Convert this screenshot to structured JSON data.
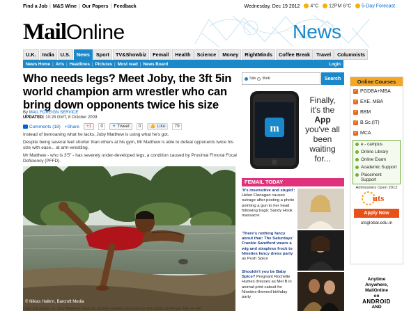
{
  "topbar": {
    "links": [
      "Find a Job",
      "M&S Wine",
      "Our Papers",
      "Feedback"
    ],
    "date": "Wednesday, Dec 19 2012",
    "temp_am": "4°C",
    "time": "12PM",
    "temp_pm": "6°C",
    "forecast": "5-Day Forecast"
  },
  "masthead": {
    "logo_bold": "Mail",
    "logo_light": "Online",
    "section": "News"
  },
  "nav": {
    "items": [
      "U.K.",
      "India",
      "U.S.",
      "News",
      "Sport",
      "TV&Showbiz",
      "Femail",
      "Health",
      "Science",
      "Money",
      "RightMinds",
      "Coffee Break",
      "Travel",
      "Columnists"
    ],
    "active": "News"
  },
  "subnav": {
    "items": [
      "News Home",
      "Arts",
      "Headlines",
      "Pictures",
      "Most read",
      "News Board"
    ],
    "login": "Login"
  },
  "article": {
    "headline": "Who needs legs? Meet Joby, the 3ft 5in world champion arm wrestler who can bring down opponents twice his size",
    "byline_prefix": "By",
    "author": "MAIL FOREIGN SERVICE",
    "updated_label": "UPDATED:",
    "updated_value": "10:28 GMT, 8 October 2009",
    "share": {
      "comments": "Comments (18)",
      "share": "Share",
      "plus_count": "0",
      "tweet": "Tweet",
      "tweet_count": "0",
      "like": "Like",
      "like_count": "79"
    },
    "paragraphs": [
      "Instead of bemoaning what he lacks, Joby Matthew is using what he's got.",
      "Despite being several feet shorter than others at his gym, Mr Matthew is able to defeat opponents twice his size with ease... at arm-wrestling.",
      "Mr Matthew - who is 3'5\" - has severely under-developed legs, a condition caused by Proximal Fimoral Focal Deficiency (PFFD)."
    ],
    "photo_credit": "© Niklas Halle'n, Barcroft Media",
    "caption_partial": "Lean but weigh: mr Joby Matthew does his routine morning exercises on the banks of Periyar river on the"
  },
  "search": {
    "opt_site": "Site",
    "opt_web": "Web",
    "button": "Search"
  },
  "app_ad": {
    "lines": [
      "Finally,",
      "it's the",
      "App",
      "you've all",
      "been",
      "waiting",
      "for..."
    ]
  },
  "femail": {
    "header": "FEMAIL TODAY",
    "stories": [
      {
        "title": "'It's insensitive and stupid':",
        "body": " Helen Flanagan causes outrage after posting a photo pointing a gun to her head following tragic Sandy Hook massacre"
      },
      {
        "title": "'There's nothing fancy about that: The Saturdays' Frankie Sandford wears a wig and strapless frock to Nineties fancy dress party",
        "body": " as Posh Spice"
      },
      {
        "title": "Shouldn't you be Baby Spice?",
        "body": " Pregnant Rochelle Humes dresses as Mel B in animal-print catsuit for Nineties-themed birthday party"
      }
    ]
  },
  "side_ad": {
    "header": "Online Courses",
    "courses": [
      "PGDBA+MBA",
      "EXE. MBA",
      "BBM",
      "B.Sc.(IT)",
      "MCA"
    ],
    "features": [
      "e - campus",
      "Online Library",
      "Online Exam",
      "Academic Support",
      "Placement Support"
    ],
    "admissions": "Admissions Open 2012",
    "brand": "uts",
    "apply": "Apply Now",
    "url": "utsglobal.edu.in"
  },
  "android": {
    "lines": [
      "Anytime",
      "Anywhere,",
      "MailOnline",
      "on"
    ],
    "brand": "ANDROID",
    "and": "AND"
  },
  "colors": {
    "accent_blue": "#1a88c9",
    "femail_pink": "#e0317d",
    "ad_orange": "#f5a623",
    "apply_red": "#e8501a"
  }
}
